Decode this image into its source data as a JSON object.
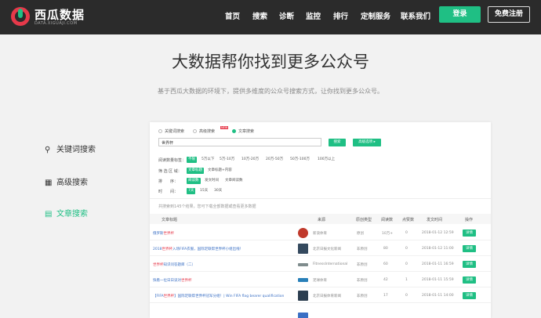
{
  "brand": {
    "name": "西瓜数据",
    "domain": "DATA.XIGUAJI.COM"
  },
  "nav": [
    "首页",
    "搜索",
    "诊断",
    "监控",
    "排行",
    "定制服务",
    "联系我们"
  ],
  "auth": {
    "login": "登录",
    "register": "免费注册"
  },
  "hero": {
    "title": "大数据帮你找到更多公众号",
    "subtitle": "基于西瓜大数据的环境下，提供多维度的公众号搜索方式，让你找到更多公众号。"
  },
  "side_menu": [
    {
      "label": "关键词搜索",
      "icon": "search-icon",
      "active": false
    },
    {
      "label": "高级搜索",
      "icon": "filter-icon",
      "active": false
    },
    {
      "label": "文章搜索",
      "icon": "article-icon",
      "active": true
    }
  ],
  "preview": {
    "modes": [
      "关键词搜索",
      "高级搜索",
      "文章搜索"
    ],
    "hot_badge": "NEW",
    "keyword": "世界杯",
    "search_btn": "搜索",
    "options_btn": "高级选项 ▸",
    "filters": {
      "reads_label": "阅读数量标签：",
      "reads": [
        "不限",
        "5万以下",
        "5万-10万",
        "10万-20万",
        "20万-50万",
        "50万-100万",
        "100万以上"
      ],
      "scope_label": "筛 选 区 域：",
      "scope": [
        "文章标题",
        "文章标题+内容"
      ],
      "sort_label": "排　　序：",
      "sort": [
        "阅读数",
        "发文时间",
        "文章阅读数"
      ],
      "time_label": "时　　间：",
      "time": [
        "7天",
        "15天",
        "30天"
      ]
    },
    "result_note": "共搜索到145个结果，您可下载全部数据或查看更多数据",
    "headers": [
      "文章标题",
      "来源",
      "原创类型",
      "阅读数",
      "点赞数",
      "发文时间",
      "操作"
    ],
    "rows": [
      {
        "pre": "俄罗斯",
        "hl": "世界杯",
        "post": "",
        "source": "新浪体育",
        "type": "原创",
        "reads": "10万+",
        "likes": "0",
        "time": "2018-01-12 12:59",
        "action": "详情",
        "avatar": "#c0392b"
      },
      {
        "pre": "2018",
        "hl": "世界杯",
        "post": "入场FIFA衣服，国际足联帮世界杯小组出线！",
        "source": "北京日报文化新闻",
        "type": "非原创",
        "reads": "80",
        "likes": "0",
        "time": "2018-01-12 11:00",
        "action": "详情",
        "avatar": "#34495e"
      },
      {
        "pre": "",
        "hl": "世界杯",
        "post": "知识问答题库（二）",
        "source": "FitnessInternational",
        "type": "非原创",
        "reads": "60",
        "likes": "0",
        "time": "2018-01-11 16:59",
        "action": "详情",
        "avatar": "#7f8c8d"
      },
      {
        "pre": "快看一位日日读对",
        "hl": "世界杯",
        "post": "",
        "source": "足球体育",
        "type": "非原创",
        "reads": "42",
        "likes": "1",
        "time": "2018-01-11 15:59",
        "action": "详情",
        "avatar": "#2980b9"
      },
      {
        "pre": "【FIFA",
        "hl": "世界杯",
        "post": "】国际足联帮世界杯冠军分组！| Win FIFA flag bearer qualification",
        "source": "北京日报体育新闻",
        "type": "非原创",
        "reads": "17",
        "likes": "0",
        "time": "2018-01-11 14:00",
        "action": "详情",
        "avatar": "#2c3e50"
      }
    ]
  },
  "colors": {
    "accent": "#1fbf84",
    "brand_red": "#e6394a",
    "topbar": "#2b2b2b",
    "link": "#3a6fc4"
  }
}
